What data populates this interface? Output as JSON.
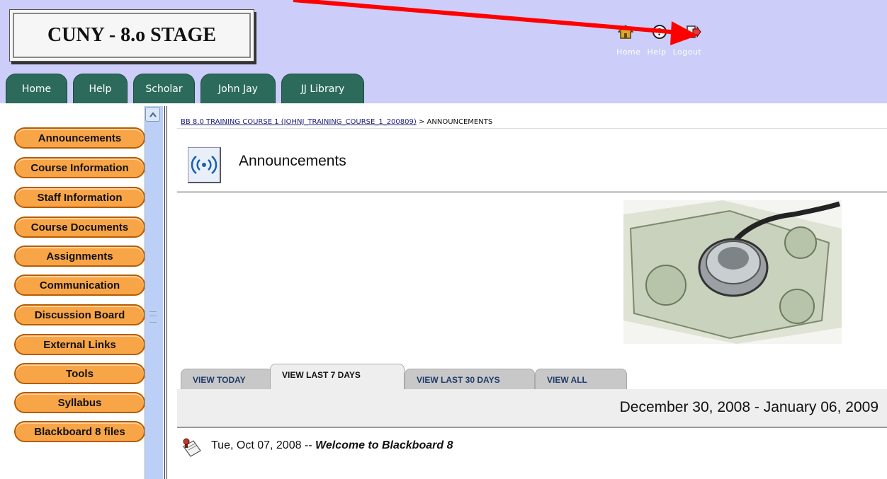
{
  "brand": {
    "title": "CUNY - 8.o STAGE"
  },
  "top_links": [
    {
      "label": "Home",
      "icon": "house-icon"
    },
    {
      "label": "Help",
      "icon": "help-icon"
    },
    {
      "label": "Logout",
      "icon": "logout-icon"
    }
  ],
  "tabs": [
    "Home",
    "Help",
    "Scholar",
    "John Jay",
    "JJ Library"
  ],
  "sidebar": {
    "items": [
      "Announcements",
      "Course Information",
      "Staff Information",
      "Course Documents",
      "Assignments",
      "Communication",
      "Discussion Board",
      "External Links",
      "Tools",
      "Syllabus",
      "Blackboard 8 files"
    ]
  },
  "breadcrumb": {
    "course_link": "BB 8.0 TRAINING COURSE 1 (JOHNJ_TRAINING_COURSE_1_200809)",
    "separator": " > ",
    "current": "ANNOUNCEMENTS"
  },
  "page": {
    "title": "Announcements"
  },
  "view_tabs": [
    {
      "label": "VIEW TODAY"
    },
    {
      "label": "VIEW LAST 7 DAYS"
    },
    {
      "label": "VIEW LAST 30 DAYS"
    },
    {
      "label": "VIEW ALL"
    }
  ],
  "date_range": "December 30, 2008 - January 06, 2009",
  "announcement": {
    "date": "Tue, Oct 07, 2008",
    "separator": " -- ",
    "title": "Welcome to Blackboard 8"
  },
  "colors": {
    "header_bg": "#cccdf8",
    "tab_green": "#2c6b5c",
    "nav_orange": "#f8a548",
    "annotation_arrow": "#ff0000"
  }
}
